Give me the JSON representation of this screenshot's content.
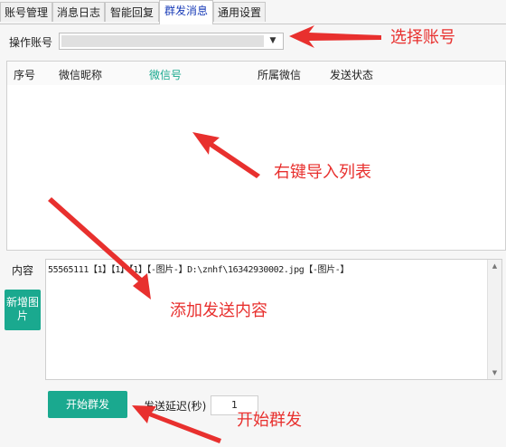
{
  "tabs": [
    {
      "label": "账号管理",
      "active": false
    },
    {
      "label": "消息日志",
      "active": false
    },
    {
      "label": "智能回复",
      "active": false
    },
    {
      "label": "群发消息",
      "active": true
    },
    {
      "label": "通用设置",
      "active": false
    }
  ],
  "account": {
    "label": "操作账号",
    "selected": ""
  },
  "list": {
    "columns": [
      "序号",
      "微信昵称",
      "微信号",
      "所属微信",
      "发送状态"
    ]
  },
  "content": {
    "label": "内容",
    "value": "55565111【1】【1】【1】【-图片-】D:\\znhf\\16342930002.jpg【-图片-】"
  },
  "buttons": {
    "add_image": "新增图片",
    "start": "开始群发"
  },
  "delay": {
    "label": "发送延迟(秒)",
    "value": "1"
  },
  "annotations": {
    "select_account": "选择账号",
    "import_list": "右键导入列表",
    "add_content": "添加发送内容",
    "start_send": "开始群发"
  },
  "colors": {
    "accent": "#1aa98f",
    "annotation": "#e8302e",
    "active_tab_text": "#1a3db8"
  }
}
